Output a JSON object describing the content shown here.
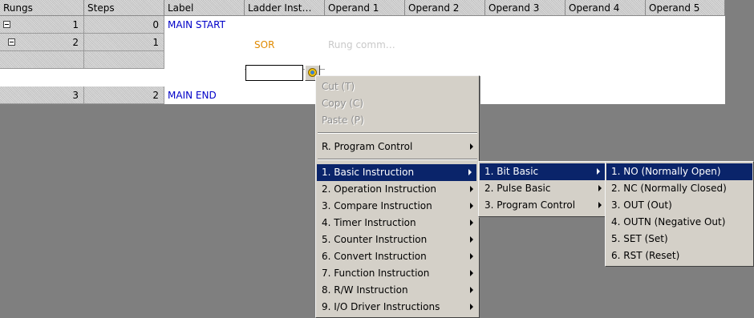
{
  "grid": {
    "headers": [
      "Rungs",
      "Steps",
      "Label",
      "Ladder Inst…",
      "Operand 1",
      "Operand 2",
      "Operand 3",
      "Operand 4",
      "Operand 5"
    ],
    "rows": [
      {
        "rung": "1",
        "step": "0",
        "label": "MAIN START"
      },
      {
        "rung": "2",
        "step": "1",
        "instruction": "SOR",
        "comment": "Rung comm…"
      },
      {
        "rung": "",
        "step": ""
      },
      {
        "rung": "3",
        "step": "2",
        "label": "MAIN END"
      }
    ]
  },
  "context_menu": {
    "edit_items": [
      "Cut (T)",
      "Copy (C)",
      "Paste (P)"
    ],
    "program_control": "R. Program Control",
    "instructions": [
      "1. Basic Instruction",
      "2. Operation Instruction",
      "3. Compare Instruction",
      "4. Timer Instruction",
      "5. Counter Instruction",
      "6. Convert Instruction",
      "7. Function Instruction",
      "8. R/W Instruction",
      "9. I/O Driver Instructions"
    ]
  },
  "submenu_basic": [
    "1. Bit Basic",
    "2. Pulse Basic",
    "3. Program Control"
  ],
  "submenu_bit": [
    "1. NO (Normally Open)",
    "2. NC (Normally Closed)",
    "3. OUT (Out)",
    "4. OUTN (Negative Out)",
    "5. SET (Set)",
    "6. RST (Reset)"
  ],
  "colors": {
    "highlight": "#0a246a",
    "label_text": "#0000c8",
    "instruction_text": "#e08a00"
  }
}
